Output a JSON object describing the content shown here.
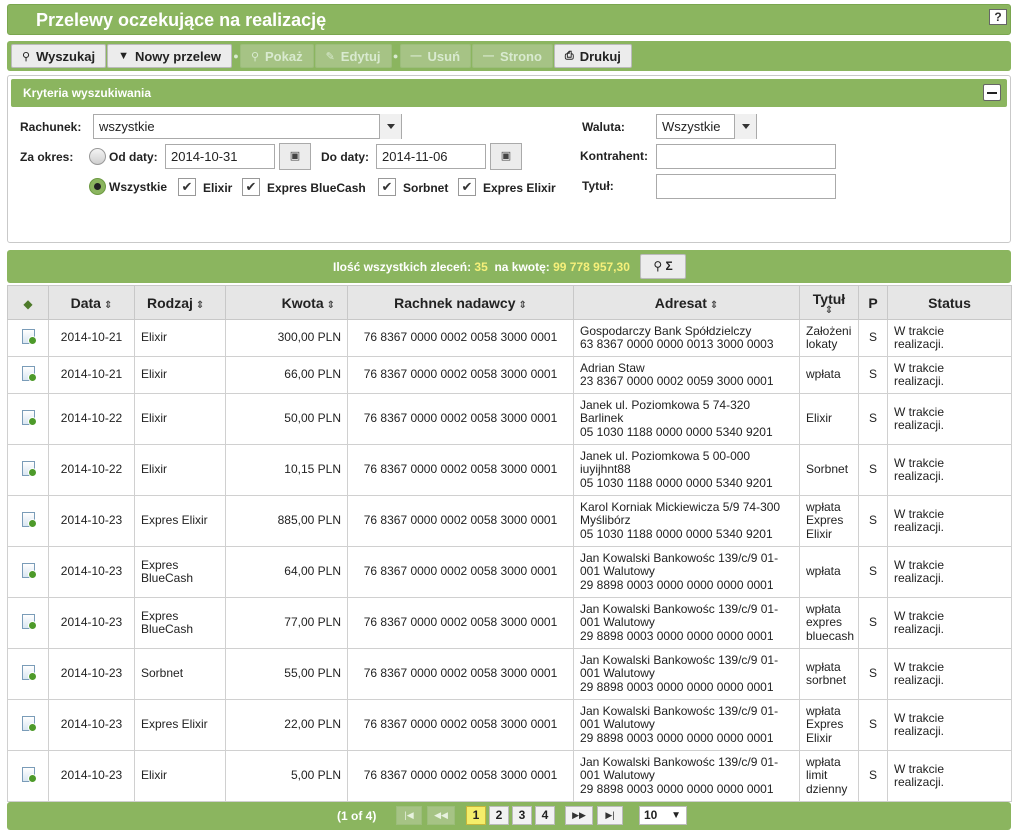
{
  "header": {
    "title": "Przelewy oczekujące na realizację",
    "help_label": "?"
  },
  "toolbar": {
    "search": "Wyszukaj",
    "new_transfer": "Nowy przelew",
    "show": "Pokaż",
    "edit": "Edytuj",
    "delete": "Usuń",
    "reverse": "Strono",
    "print": "Drukuj"
  },
  "criteria": {
    "title": "Kryteria wyszukiwania",
    "account_label": "Rachunek:",
    "account_value": "wszystkie",
    "period_label": "Za okres:",
    "from_label": "Od daty:",
    "from_value": "2014-10-31",
    "to_label": "Do daty:",
    "to_value": "2014-11-06",
    "all_label": "Wszystkie",
    "types": [
      "Elixir",
      "Expres BlueCash",
      "Sorbnet",
      "Expres Elixir"
    ],
    "currency_label": "Waluta:",
    "currency_value": "Wszystkie",
    "contractor_label": "Kontrahent:",
    "title_label": "Tytuł:"
  },
  "summary": {
    "count_label": "Ilość wszystkich zleceń:",
    "count": "35",
    "amount_label": "na kwotę:",
    "amount": "99 778 957,30",
    "button_label": "Σ"
  },
  "table": {
    "headers": [
      "Data",
      "Rodzaj",
      "Kwota",
      "Rachnek nadawcy",
      "Adresat",
      "Tytuł",
      "P",
      "Status"
    ],
    "rows": [
      {
        "date": "2014-10-21",
        "type": "Elixir",
        "amount": "300,00 PLN",
        "sender": "76 8367 0000 0002 0058 3000 0001",
        "recipient": [
          "Gospodarczy Bank Spółdzielczy",
          "63 8367 0000 0000 0013 3000 0003"
        ],
        "title": [
          "Założeni",
          "lokaty"
        ],
        "p": "S",
        "status": [
          "W trakcie",
          "realizacji."
        ]
      },
      {
        "date": "2014-10-21",
        "type": "Elixir",
        "amount": "66,00 PLN",
        "sender": "76 8367 0000 0002 0058 3000 0001",
        "recipient": [
          "Adrian Staw",
          "23 8367 0000 0002 0059 3000 0001"
        ],
        "title": [
          "wpłata"
        ],
        "p": "S",
        "status": [
          "W trakcie",
          "realizacji."
        ]
      },
      {
        "date": "2014-10-22",
        "type": "Elixir",
        "amount": "50,00 PLN",
        "sender": "76 8367 0000 0002 0058 3000 0001",
        "recipient": [
          "Janek ul. Poziomkowa 5 74-320",
          "Barlinek",
          "05 1030 1188 0000 0000 5340 9201"
        ],
        "title": [
          "Elixir"
        ],
        "p": "S",
        "status": [
          "W trakcie",
          "realizacji."
        ]
      },
      {
        "date": "2014-10-22",
        "type": "Elixir",
        "amount": "10,15 PLN",
        "sender": "76 8367 0000 0002 0058 3000 0001",
        "recipient": [
          "Janek ul. Poziomkowa 5 00-000",
          "iuyijhnt88",
          "05 1030 1188 0000 0000 5340 9201"
        ],
        "title": [
          "Sorbnet"
        ],
        "p": "S",
        "status": [
          "W trakcie",
          "realizacji."
        ]
      },
      {
        "date": "2014-10-23",
        "type": "Expres Elixir",
        "amount": "885,00 PLN",
        "sender": "76 8367 0000 0002 0058 3000 0001",
        "recipient": [
          "Karol Korniak Mickiewicza 5/9 74-300",
          "Myślibórz",
          "05 1030 1188 0000 0000 5340 9201"
        ],
        "title": [
          "wpłata",
          "Expres",
          "Elixir"
        ],
        "p": "S",
        "status": [
          "W trakcie",
          "realizacji."
        ]
      },
      {
        "date": "2014-10-23",
        "type": "Expres BlueCash",
        "amount": "64,00 PLN",
        "sender": "76 8367 0000 0002 0058 3000 0001",
        "recipient": [
          "Jan Kowalski Bankowośc 139/c/9 01-",
          "001 Walutowy",
          "29 8898 0003 0000 0000 0000 0001"
        ],
        "title": [
          "wpłata"
        ],
        "p": "S",
        "status": [
          "W trakcie",
          "realizacji."
        ]
      },
      {
        "date": "2014-10-23",
        "type": "Expres BlueCash",
        "amount": "77,00 PLN",
        "sender": "76 8367 0000 0002 0058 3000 0001",
        "recipient": [
          "Jan Kowalski Bankowośc 139/c/9 01-",
          "001 Walutowy",
          "29 8898 0003 0000 0000 0000 0001"
        ],
        "title": [
          "wpłata",
          "expres",
          "bluecash"
        ],
        "p": "S",
        "status": [
          "W trakcie",
          "realizacji."
        ]
      },
      {
        "date": "2014-10-23",
        "type": "Sorbnet",
        "amount": "55,00 PLN",
        "sender": "76 8367 0000 0002 0058 3000 0001",
        "recipient": [
          "Jan Kowalski Bankowośc 139/c/9 01-",
          "001 Walutowy",
          "29 8898 0003 0000 0000 0000 0001"
        ],
        "title": [
          "wpłata",
          "sorbnet"
        ],
        "p": "S",
        "status": [
          "W trakcie",
          "realizacji."
        ]
      },
      {
        "date": "2014-10-23",
        "type": "Expres Elixir",
        "amount": "22,00 PLN",
        "sender": "76 8367 0000 0002 0058 3000 0001",
        "recipient": [
          "Jan Kowalski Bankowośc 139/c/9 01-",
          "001 Walutowy",
          "29 8898 0003 0000 0000 0000 0001"
        ],
        "title": [
          "wpłata",
          "Expres",
          "Elixir"
        ],
        "p": "S",
        "status": [
          "W trakcie",
          "realizacji."
        ]
      },
      {
        "date": "2014-10-23",
        "type": "Elixir",
        "amount": "5,00 PLN",
        "sender": "76 8367 0000 0002 0058 3000 0001",
        "recipient": [
          "Jan Kowalski Bankowośc 139/c/9 01-",
          "001 Walutowy",
          "29 8898 0003 0000 0000 0000 0001"
        ],
        "title": [
          "wpłata",
          "limit",
          "dzienny"
        ],
        "p": "S",
        "status": [
          "W trakcie",
          "realizacji."
        ]
      }
    ]
  },
  "pager": {
    "info": "(1 of 4)",
    "pages": [
      "1",
      "2",
      "3",
      "4"
    ],
    "current_page": "1",
    "page_size": "10"
  }
}
